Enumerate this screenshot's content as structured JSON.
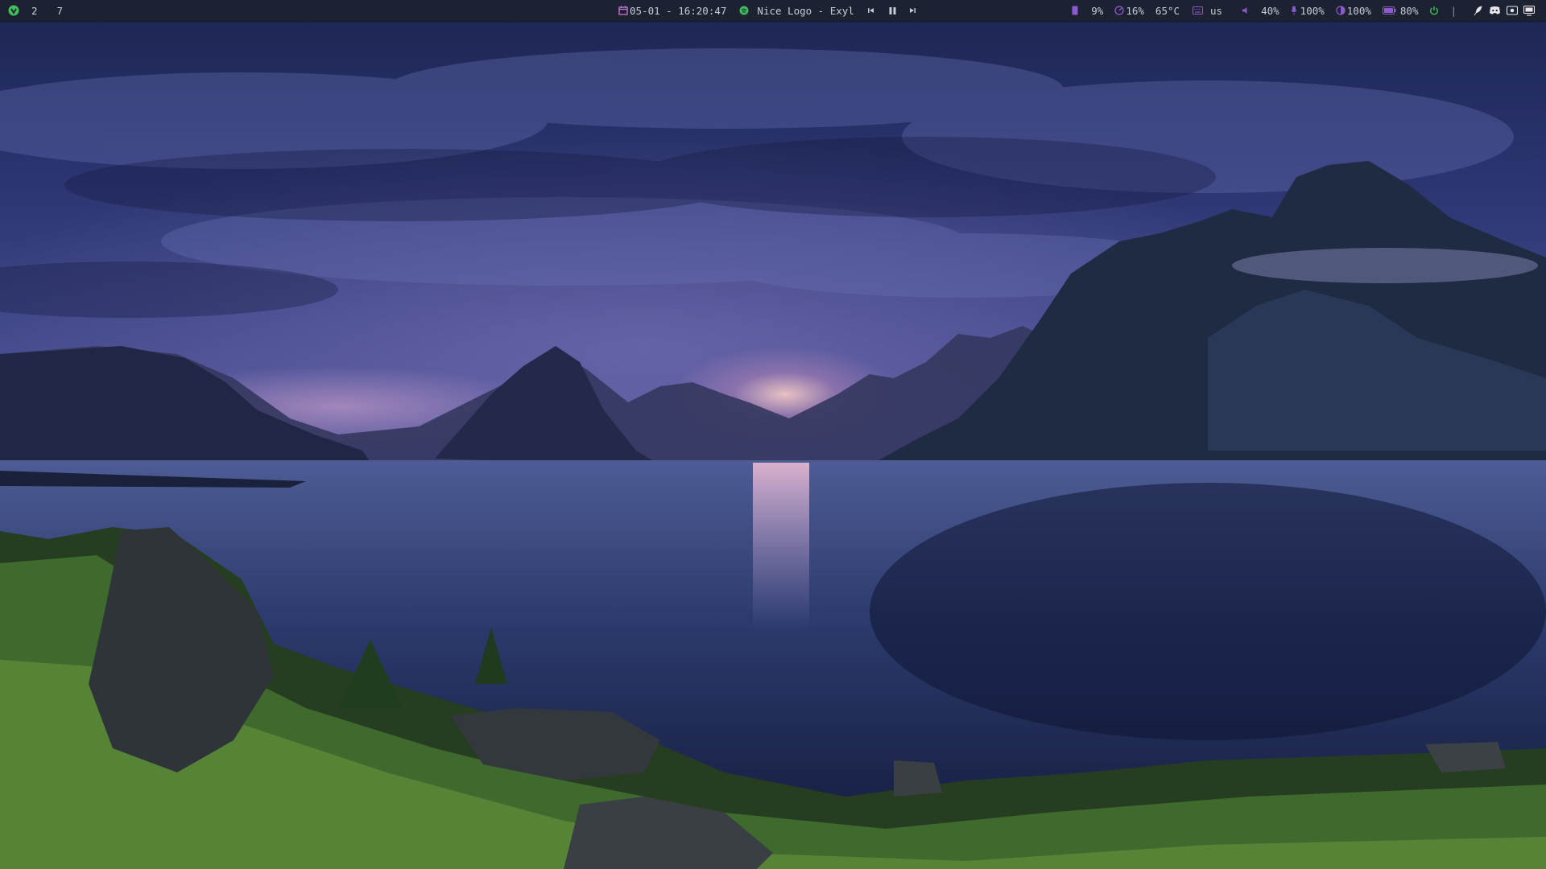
{
  "workspaces": [
    "2",
    "7"
  ],
  "clock": {
    "text": "05-01 - 16:20:47"
  },
  "media": {
    "track": "Nice Logo - Exyl"
  },
  "status": {
    "memory": "9%",
    "cpu": "16%",
    "temperature": "65°C",
    "keyboard_layout": "us",
    "volume": "40%",
    "microphone": "100%",
    "brightness": "100%",
    "battery": "80%",
    "divider": "|"
  },
  "colors": {
    "bar_background": "#1d2233",
    "bar_text": "#c9ccd6",
    "accent_purple": "#8c5ad0",
    "accent_green": "#3fbf5a"
  },
  "icons": {
    "launcher": "debian-logo-icon",
    "calendar": "calendar-icon",
    "spotify": "spotify-icon",
    "prev": "previous-track-icon",
    "pause": "pause-icon",
    "next": "next-track-icon",
    "memory": "memory-icon",
    "cpu": "cpu-gauge-icon",
    "keyboard": "keyboard-icon",
    "volume": "volume-icon",
    "microphone": "microphone-icon",
    "brightness": "brightness-icon",
    "battery": "battery-icon",
    "power": "power-icon",
    "tray": [
      "tray-feather-icon",
      "discord-icon",
      "tray-steam-icon",
      "tray-monitor-icon"
    ]
  }
}
